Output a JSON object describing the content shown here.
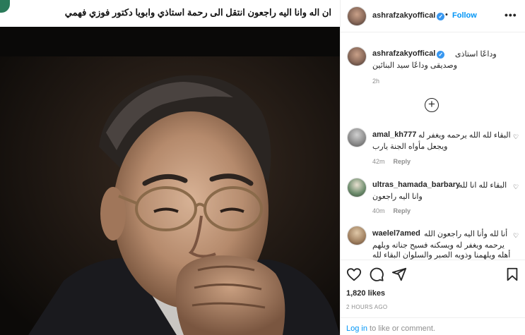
{
  "overlay_caption": "ان اله وانا اليه راجعون انتقل الى رحمة استاذي وابويا دكتور فوزي فهمي",
  "post": {
    "username": "ashrafzakyoffical",
    "separator": "•",
    "follow_label": "Follow",
    "more_label": "•••"
  },
  "caption": {
    "username": "ashrafzakyoffical",
    "line1": "وداعًا استاذى",
    "line2": "وصديقى وداعًا سيد البنائين",
    "time": "2h"
  },
  "load_more_label": "+",
  "comments": [
    {
      "username": "amal_kh777",
      "line1": "البقاء لله الله يرحمه ويغفر له",
      "line2": "ويجعل مأواه الجنة يارب",
      "line3": "",
      "time": "42m",
      "reply": "Reply",
      "avatar_color": "#8a8a8a"
    },
    {
      "username": "ultras_hamada_barbary",
      "line1": "البقاء لله انا لله",
      "line2": "وانا اليه راجعون",
      "line3": "",
      "time": "40m",
      "reply": "Reply",
      "avatar_color": "#6a8a6a"
    },
    {
      "username": "waelel7amed",
      "line1": "أنا لله وأنا اليه راجعون الله",
      "line2": "يرحمه ويغفر له ويسكنه فسيح جناته ويلهم",
      "line3": "أهله ويلهمنا وذويه الصبر والسلوان البقاء لله",
      "time": "",
      "reply": "",
      "avatar_color": "#a08060"
    }
  ],
  "likes": "1,820 likes",
  "date": "2 HOURS AGO",
  "login": {
    "link": "Log in",
    "rest": " to like or comment."
  },
  "icons": {
    "heart": "heart-icon",
    "comment": "comment-icon",
    "share": "share-icon",
    "save": "save-icon"
  },
  "colors": {
    "accent": "#0095f6",
    "verified": "#3897f0",
    "muted": "#8e8e8e",
    "text": "#262626"
  }
}
